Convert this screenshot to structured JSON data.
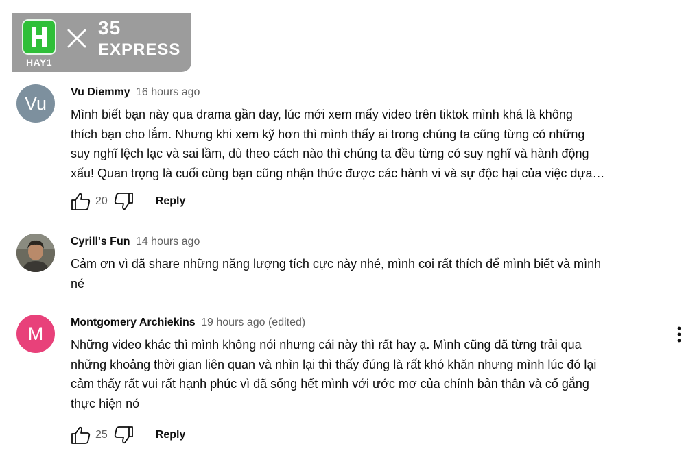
{
  "watermark": {
    "brand_left": "HAY1",
    "brand_right_number": "35",
    "brand_right_word": "EXPRESS"
  },
  "comments": [
    {
      "author": "Vu Diemmy",
      "time": "16 hours ago",
      "avatar_initials": "Vu",
      "avatar_color": "#7d909e",
      "lines": [
        "Mình biết bạn này qua drama gần day, lúc mới xem mấy video trên tiktok mình khá là không",
        "thích bạn cho lắm. Nhưng khi xem kỹ hơn thì mình thấy ai trong chúng ta cũng từng có những",
        "suy nghĩ lệch lạc và sai lầm, dù theo cách nào thì chúng ta đều từng có suy nghĩ và hành động",
        "xấu! Quan trọng là cuối cùng  bạn cũng nhận thức được các hành vi và sự độc hại của việc dựa…"
      ],
      "likes": "20",
      "reply_label": "Reply"
    },
    {
      "author": "Cyrill's Fun",
      "time": "14 hours ago",
      "avatar_initials": "",
      "avatar_color": "#4d4a44",
      "lines": [
        "Cảm ơn vì đã share những năng lượng tích cực này nhé, mình coi rất thích để mình biết và mình",
        "né"
      ]
    },
    {
      "author": "Montgomery Archiekins",
      "time": "19 hours ago (edited)",
      "avatar_initials": "M",
      "avatar_color": "#e8417a",
      "lines": [
        "Những video khác thì mình không nói nhưng cái này thì rất hay ạ. Mình cũng đã từng trải qua",
        "những khoảng thời gian liên quan và nhìn lại thì thấy đúng là rất khó khăn nhưng mình lúc đó lại",
        "cảm thấy rất vui rất hạnh phúc vì đã sống hết mình với ước mơ của chính bản thân và cố gắng",
        "thực hiện nó"
      ],
      "likes": "25",
      "reply_label": "Reply"
    }
  ]
}
